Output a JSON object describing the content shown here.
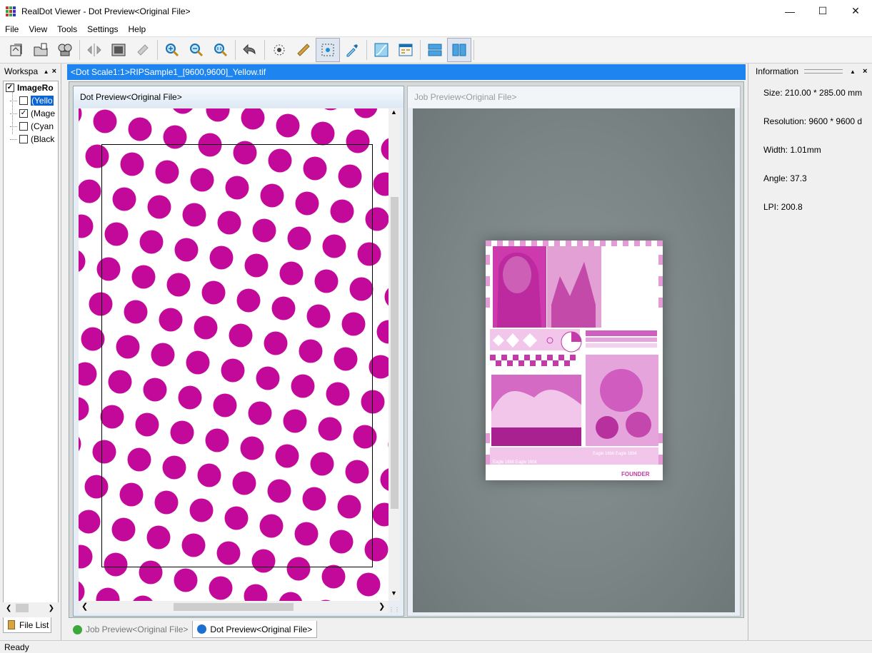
{
  "window": {
    "title": "RealDot Viewer - Dot Preview<Original File>"
  },
  "menu": {
    "items": [
      "File",
      "View",
      "Tools",
      "Settings",
      "Help"
    ]
  },
  "toolbar": {
    "buttons": [
      {
        "name": "open-file-icon"
      },
      {
        "name": "open-folder-icon"
      },
      {
        "name": "batch-icon"
      },
      {
        "name": "move-icon"
      },
      {
        "name": "fit-window-icon"
      },
      {
        "name": "rotate-icon"
      },
      {
        "name": "zoom-in-icon"
      },
      {
        "name": "zoom-out-icon"
      },
      {
        "name": "zoom-actual-icon"
      },
      {
        "name": "undo-icon"
      },
      {
        "name": "dot-grid-icon"
      },
      {
        "name": "ruler-icon"
      },
      {
        "name": "dot-select-icon"
      },
      {
        "name": "eyedropper-icon"
      },
      {
        "name": "curve-icon"
      },
      {
        "name": "layout-icon"
      },
      {
        "name": "split-horizontal-icon"
      },
      {
        "name": "split-vertical-icon"
      }
    ]
  },
  "workspace": {
    "title": "Workspa",
    "root_label": "ImageRo",
    "items": [
      {
        "label": "(Yello",
        "checked": false,
        "selected": true
      },
      {
        "label": "(Mage",
        "checked": true,
        "selected": false
      },
      {
        "label": "(Cyan",
        "checked": false,
        "selected": false
      },
      {
        "label": "(Black",
        "checked": false,
        "selected": false
      }
    ],
    "file_list_tab": "File List"
  },
  "document": {
    "title": "<Dot Scale1:1>RIPSample1_[9600,9600]_Yellow.tif"
  },
  "dot_preview": {
    "header": "Dot Preview<Original File>",
    "dot_color": "#c3099a"
  },
  "job_preview": {
    "header": "Job Preview<Original File>",
    "brand": "FOUNDER",
    "caption": "Eagle 16bit Eagle 16bit"
  },
  "bottom_tabs": [
    {
      "label": "Job Preview<Original File>",
      "active": false
    },
    {
      "label": "Dot Preview<Original File>",
      "active": true
    }
  ],
  "information": {
    "title": "Information",
    "size": "Size: 210.00 * 285.00 mm",
    "resolution": "Resolution: 9600 * 9600 d",
    "width": "Width: 1.01mm",
    "angle": "Angle: 37.3",
    "lpi": "LPI: 200.8"
  },
  "status": {
    "text": "Ready"
  }
}
